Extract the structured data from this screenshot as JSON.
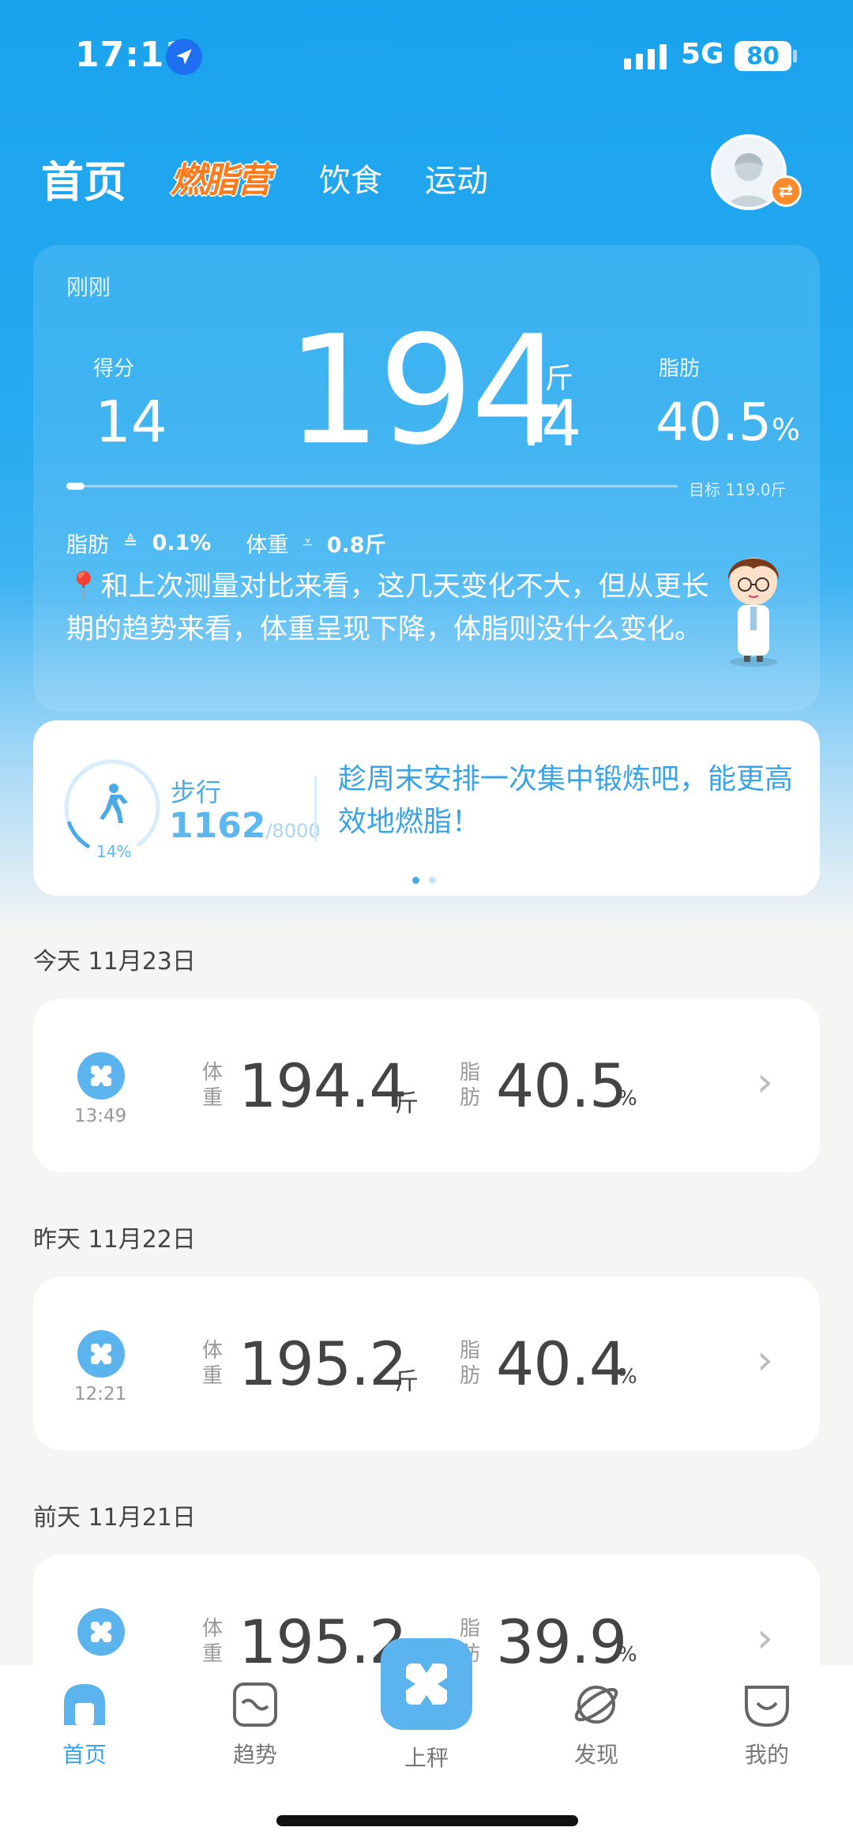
{
  "status_bar": {
    "time": "17:11",
    "network": "5G",
    "battery": "80"
  },
  "top_nav": {
    "home": "首页",
    "camp": "燃脂营",
    "diet": "饮食",
    "sport": "运动"
  },
  "summary": {
    "time_label": "刚刚",
    "score_label": "得分",
    "score_value": "14",
    "weight_int": "194",
    "weight_dec": ".4",
    "weight_unit": "斤",
    "fat_label": "脂肪",
    "fat_value": "40.5",
    "fat_unit": "%",
    "goal_text": "目标 119.0斤",
    "goal_progress": 0.03,
    "fat_delta_label": "脂肪",
    "fat_delta_value": "0.1%",
    "weight_delta_label": "体重",
    "weight_delta_value": "0.8斤",
    "advice": "和上次测量对比来看，这几天变化不大，但从更长期的趋势来看，体重呈现下降，体脂则没什么变化。"
  },
  "steps": {
    "label": "步行",
    "count": "1162",
    "goal": "/8000",
    "percent": "14%",
    "progress": 0.14,
    "tip": "趁周末安排一次集中锻炼吧，能更高效地燃脂！"
  },
  "records": [
    {
      "day": "今天 11月23日",
      "time": "13:49",
      "weight_label": "体重",
      "weight": "194.4",
      "weight_unit": "斤",
      "fat_label": "脂肪",
      "fat": "40.5",
      "fat_unit": "%"
    },
    {
      "day": "昨天 11月22日",
      "time": "12:21",
      "weight_label": "体重",
      "weight": "195.2",
      "weight_unit": "斤",
      "fat_label": "脂肪",
      "fat": "40.4",
      "fat_unit": "%"
    },
    {
      "day": "前天 11月21日",
      "time": "",
      "weight_label": "体重",
      "weight": "195.2",
      "weight_unit": "斤",
      "fat_label": "脂肪",
      "fat": "39.9",
      "fat_unit": "%"
    }
  ],
  "tabbar": {
    "home": "首页",
    "trend": "趋势",
    "weigh": "上秤",
    "discover": "发现",
    "mine": "我的"
  },
  "colors": {
    "accent": "#3aa3e5",
    "hero": "#1aa3ee",
    "camp": "#ff7a1a"
  }
}
